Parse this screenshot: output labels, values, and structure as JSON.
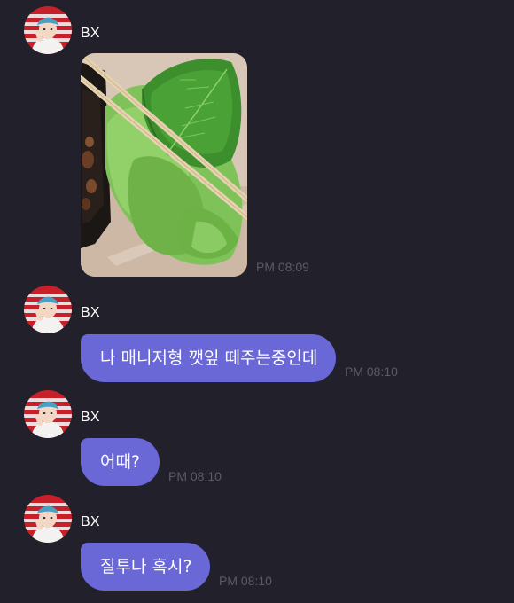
{
  "chat": {
    "messages": [
      {
        "sender": "BX",
        "type": "image",
        "time": "PM 08:09"
      },
      {
        "sender": "BX",
        "type": "text",
        "text": "나 매니저형 깻잎 떼주는중인데",
        "time": "PM 08:10"
      },
      {
        "sender": "BX",
        "type": "text",
        "text": "어때?",
        "time": "PM 08:10"
      },
      {
        "sender": "BX",
        "type": "text",
        "text": "질투나 혹시?",
        "time": "PM 08:10"
      }
    ]
  },
  "colors": {
    "background": "#22212b",
    "bubble": "#6a67d7",
    "timestamp": "#5b5a66",
    "avatar_ring": "#c8202a"
  },
  "icons": {
    "avatar": "profile-avatar-icon"
  }
}
